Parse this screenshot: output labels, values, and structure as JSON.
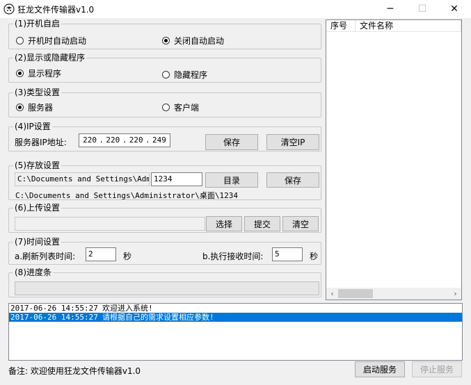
{
  "window": {
    "title": "狂龙文件传输器v1.0",
    "minimize": "─",
    "maximize": "☐",
    "close": "✕"
  },
  "startup": {
    "legend": "(1)开机自启",
    "options": [
      {
        "label": "开机时自动启动",
        "checked": false
      },
      {
        "label": "关闭自动启动",
        "checked": true
      }
    ]
  },
  "visibility": {
    "legend": "(2)显示或隐藏程序",
    "options": [
      {
        "label": "显示程序",
        "checked": true
      },
      {
        "label": "隐藏程序",
        "checked": false
      }
    ]
  },
  "type": {
    "legend": "(3)类型设置",
    "options": [
      {
        "label": "服务器",
        "checked": true
      },
      {
        "label": "客户端",
        "checked": false
      }
    ]
  },
  "ip": {
    "legend": "(4)IP设置",
    "label": "服务器IP地址:",
    "octets": [
      "220",
      "220",
      "220",
      "249"
    ],
    "dot": ".",
    "save_label": "保存",
    "clear_label": "清空IP"
  },
  "storage": {
    "legend": "(5)存放设置",
    "path_value": "C:\\Documents and Settings\\Administrator\\桌面",
    "name_value": "1234",
    "dir_label": "目录",
    "save_label": "保存",
    "full_path": "C:\\Documents and Settings\\Administrator\\桌面\\1234"
  },
  "upload": {
    "legend": "(6)上传设置",
    "file_value": "",
    "select_label": "选择",
    "submit_label": "提交",
    "clear_label": "清空"
  },
  "timing": {
    "legend": "(7)时间设置",
    "refresh_label": "a.刷新列表时间:",
    "refresh_value": "2",
    "refresh_unit": "秒",
    "receive_label": "b.执行接收时间:",
    "receive_value": "5",
    "receive_unit": "秒"
  },
  "progress": {
    "legend": "(8)进度条",
    "value": 0
  },
  "filelist": {
    "columns": [
      "序号",
      "文件名称"
    ],
    "scroll_left": "‹",
    "scroll_right": "›"
  },
  "log": [
    {
      "time": "2017-06-26 14:55:27",
      "message": "欢迎进入系统!",
      "selected": false
    },
    {
      "time": "2017-06-26 14:55:27",
      "message": "请根据自己的需求设置相应参数!",
      "selected": true
    }
  ],
  "footer": {
    "note": "备注: 欢迎使用狂龙文件传输器v1.0",
    "start_label": "启动服务",
    "stop_label": "停止服务"
  }
}
